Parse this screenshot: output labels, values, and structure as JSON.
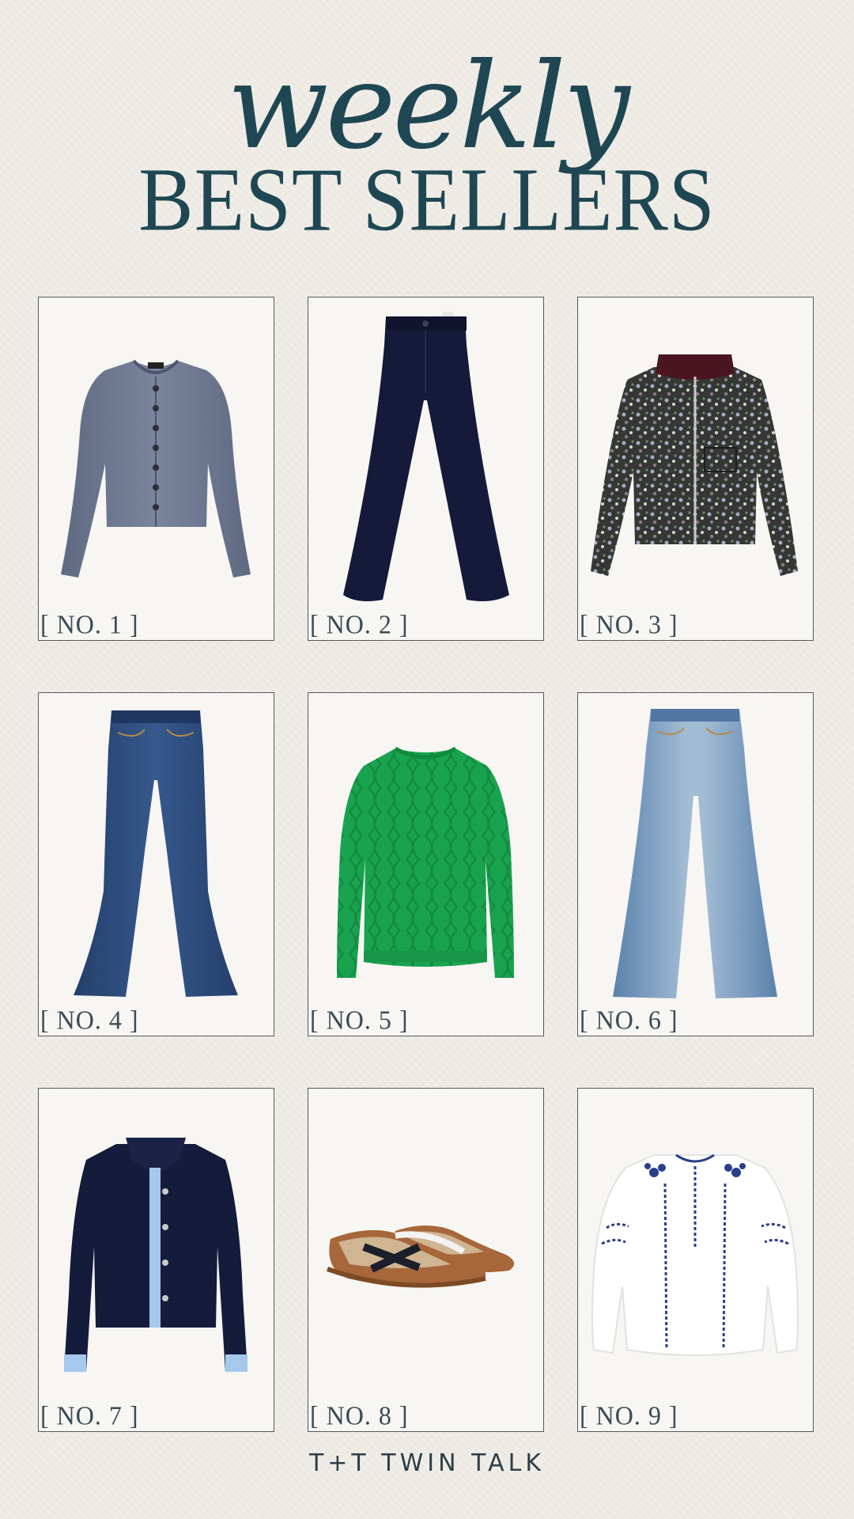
{
  "header": {
    "script_title": "weekly",
    "title": "BEST SELLERS"
  },
  "products": [
    {
      "rank_label": "[ NO. 1 ]",
      "icon": "cardigan-icon",
      "color": "#6e7891"
    },
    {
      "rank_label": "[ NO. 2 ]",
      "icon": "wide-leg-pants-icon",
      "color": "#151a3a"
    },
    {
      "rank_label": "[ NO. 3 ]",
      "icon": "floral-jacket-icon",
      "color": "#3a3d3a"
    },
    {
      "rank_label": "[ NO. 4 ]",
      "icon": "flare-jeans-icon",
      "color": "#2d4a78"
    },
    {
      "rank_label": "[ NO. 5 ]",
      "icon": "cable-sweater-icon",
      "color": "#1aa34f"
    },
    {
      "rank_label": "[ NO. 6 ]",
      "icon": "wide-jeans-icon",
      "color": "#6d92b9"
    },
    {
      "rank_label": "[ NO. 7 ]",
      "icon": "knit-jacket-icon",
      "color": "#151b3b"
    },
    {
      "rank_label": "[ NO. 8 ]",
      "icon": "sneakers-icon",
      "color": "#a7673a"
    },
    {
      "rank_label": "[ NO. 9 ]",
      "icon": "embroidered-blouse-icon",
      "color": "#ffffff"
    }
  ],
  "footer": {
    "brand": "T+T TWIN TALK"
  }
}
